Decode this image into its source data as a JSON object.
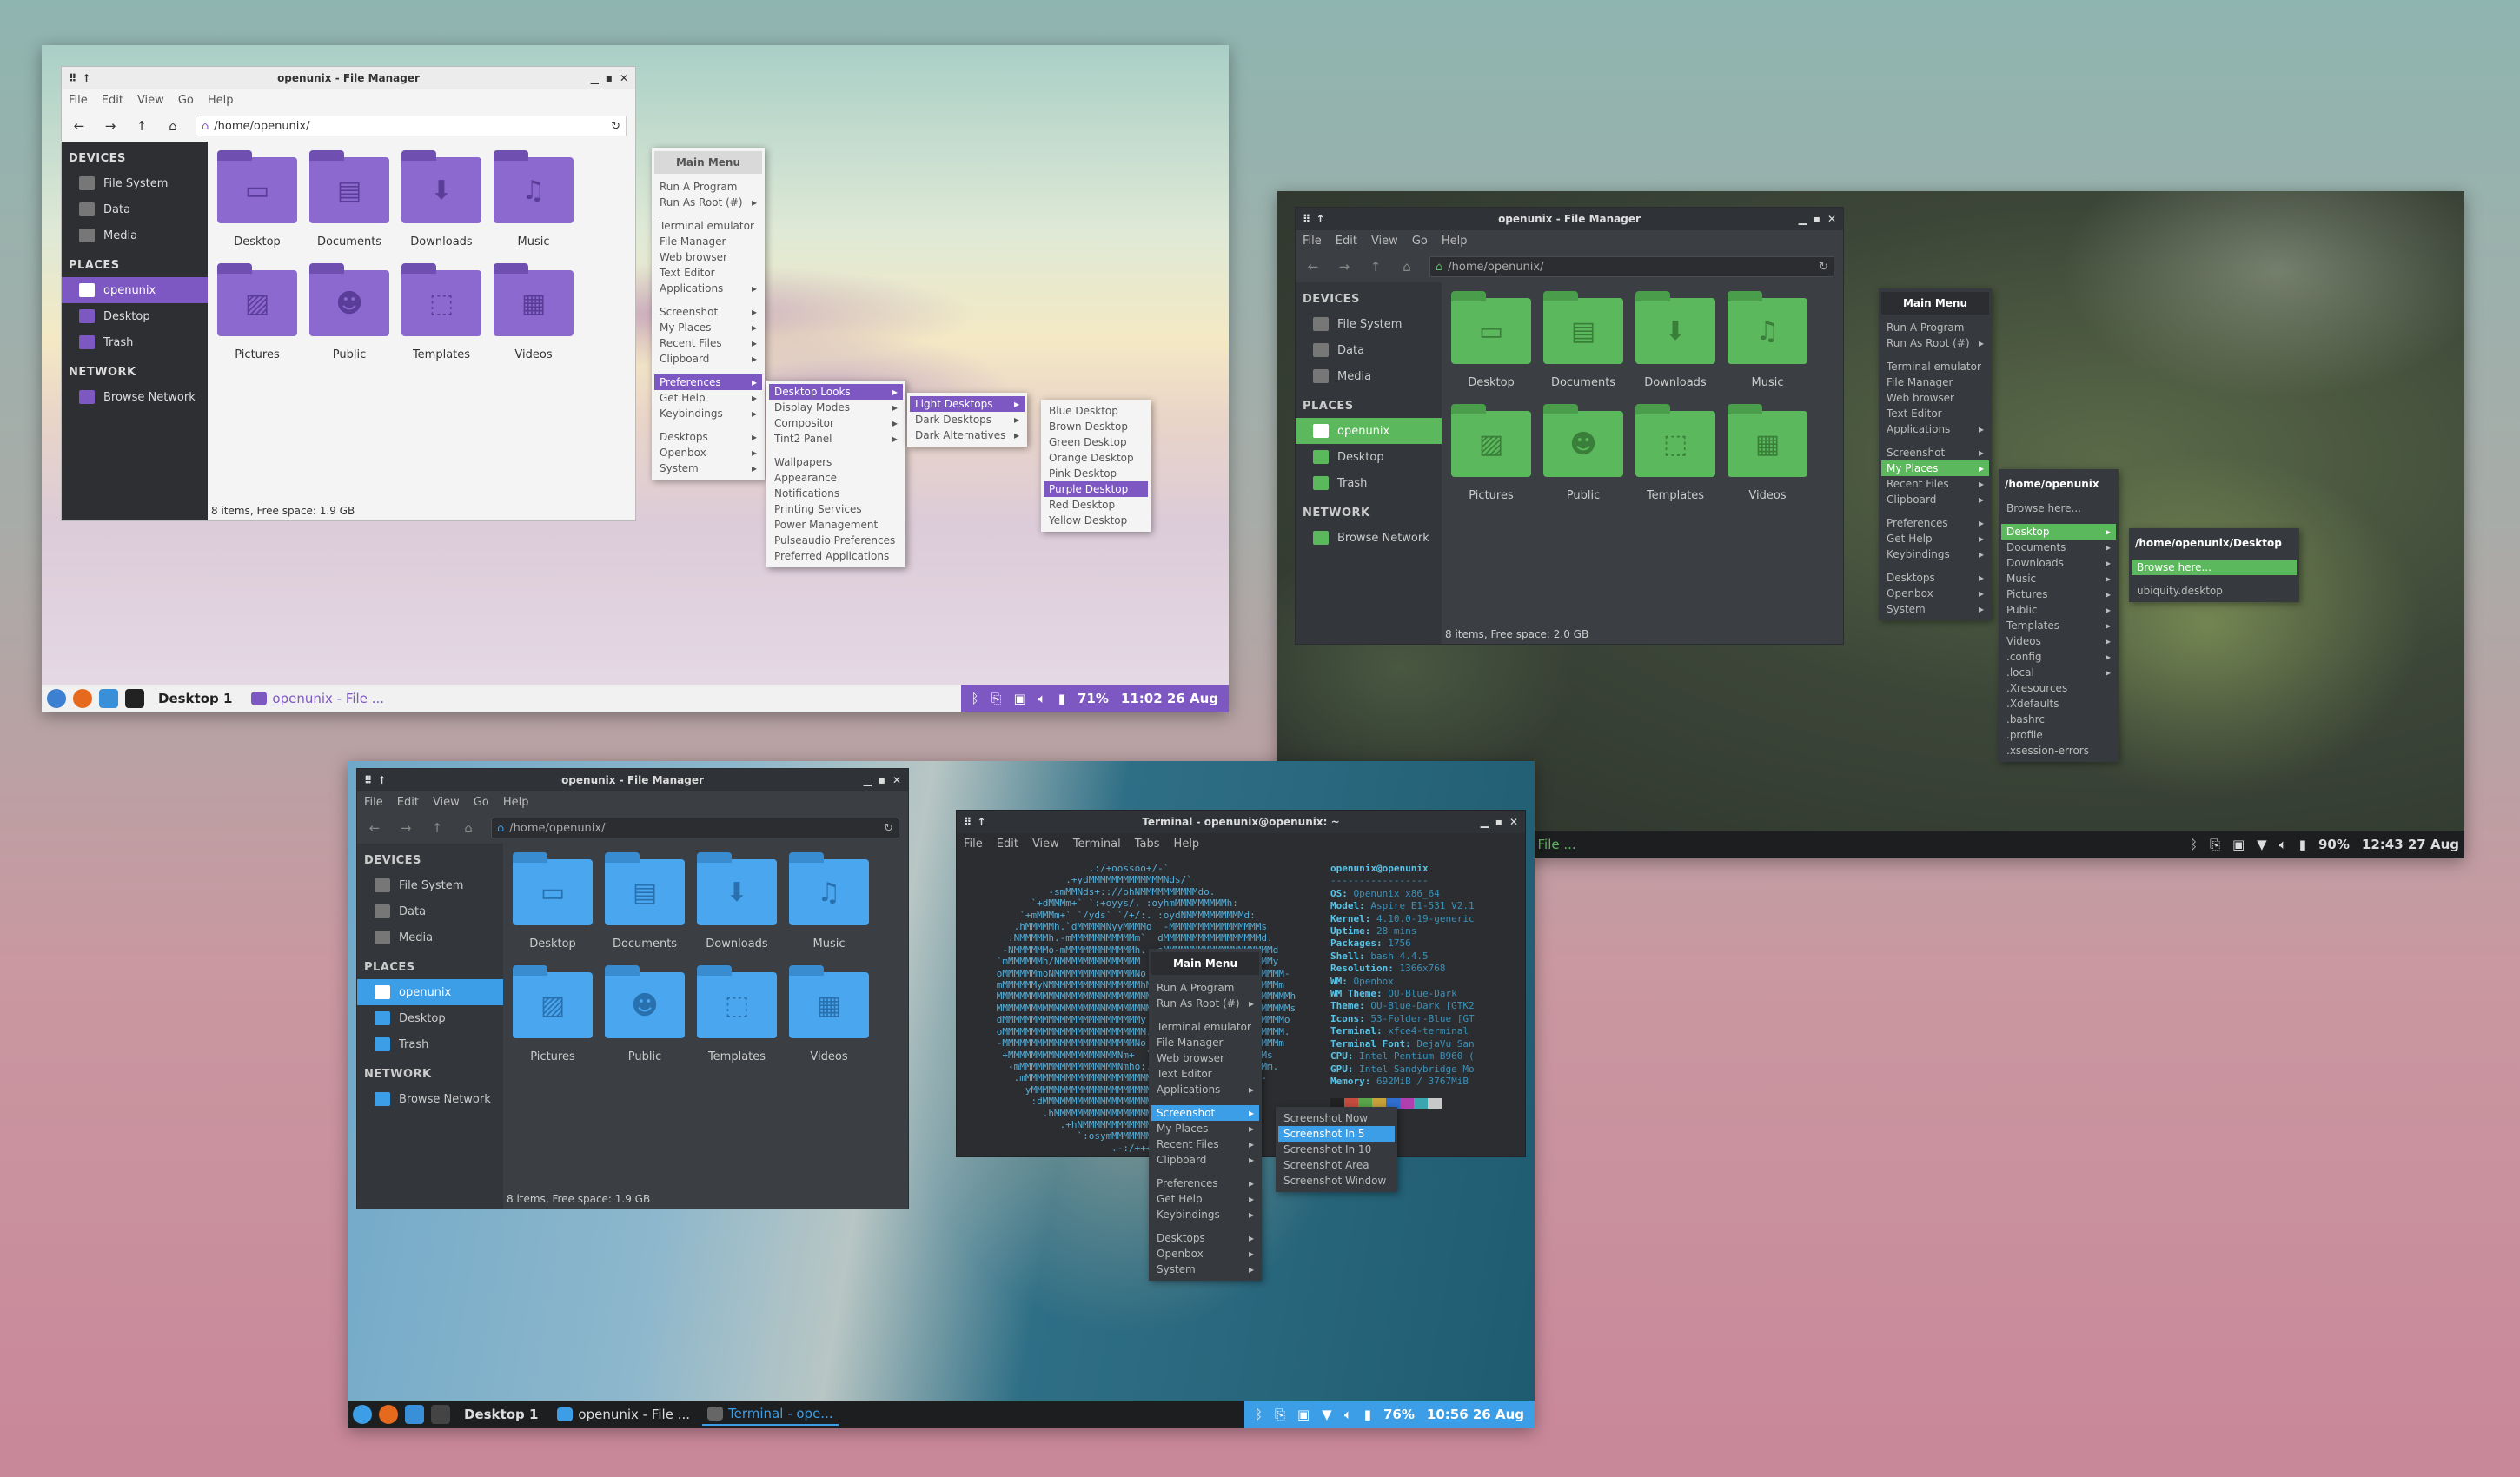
{
  "fm_menubar": [
    "File",
    "Edit",
    "View",
    "Go",
    "Help"
  ],
  "fm_path": "/home/openunix/",
  "fm_title": "openunix - File Manager",
  "sidebar": {
    "devices": "DEVICES",
    "places": "PLACES",
    "network": "NETWORK",
    "device_items": [
      "File System",
      "Data",
      "Media"
    ],
    "place_items": [
      "openunix",
      "Desktop",
      "Trash"
    ],
    "network_items": [
      "Browse Network"
    ]
  },
  "folders": [
    "Desktop",
    "Documents",
    "Downloads",
    "Music",
    "Pictures",
    "Public",
    "Templates",
    "Videos"
  ],
  "folder_icons": [
    "desktop-icon",
    "document-icon",
    "download-icon",
    "music-icon",
    "pictures-icon",
    "users-icon",
    "template-icon",
    "video-icon"
  ],
  "shot1": {
    "status": "8 items, Free space: 1.9 GB",
    "accent": "#7d57c2",
    "main_menu": {
      "title": "Main Menu",
      "items": [
        "Run A Program",
        "Run As Root (#)",
        "",
        "Terminal emulator",
        "File Manager",
        "Web browser",
        "Text Editor",
        "Applications",
        "",
        "Screenshot",
        "My Places",
        "Recent Files",
        "Clipboard",
        "",
        "Preferences",
        "Get Help",
        "Keybindings",
        "",
        "Desktops",
        "Openbox",
        "System"
      ]
    },
    "pref_menu": [
      "Desktop Looks",
      "Display Modes",
      "Compositor",
      "Tint2 Panel",
      "",
      "Wallpapers",
      "Appearance",
      "Notifications",
      "Printing Services",
      "Power Management",
      "Pulseaudio Preferences",
      "Preferred Applications"
    ],
    "looks_menu": [
      "Light Desktops",
      "Dark Desktops",
      "Dark Alternatives"
    ],
    "light_menu": [
      "Blue Desktop",
      "Brown Desktop",
      "Green Desktop",
      "Orange Desktop",
      "Pink Desktop",
      "Purple Desktop",
      "Red Desktop",
      "Yellow Desktop"
    ],
    "panel": {
      "desktop": "Desktop 1",
      "task": "openunix - File ...",
      "battery": "71%",
      "clock": "11:02 26 Aug"
    }
  },
  "shot2": {
    "status": "8 items, Free space: 2.0 GB",
    "accent": "#5cb85c",
    "main_menu": {
      "title": "Main Menu",
      "items": [
        "Run A Program",
        "Run As Root (#)",
        "",
        "Terminal emulator",
        "File Manager",
        "Web browser",
        "Text Editor",
        "Applications",
        "",
        "Screenshot",
        "My Places",
        "Recent Files",
        "Clipboard",
        "",
        "Preferences",
        "Get Help",
        "Keybindings",
        "",
        "Desktops",
        "Openbox",
        "System"
      ]
    },
    "places_menu": {
      "title": "/home/openunix",
      "browse": "Browse here...",
      "items": [
        "Desktop",
        "Documents",
        "Downloads",
        "Music",
        "Pictures",
        "Public",
        "Templates",
        "Videos",
        ".config",
        ".local",
        ".Xresources",
        ".Xdefaults",
        ".bashrc",
        ".profile",
        ".xsession-errors"
      ]
    },
    "desktop_menu": {
      "title": "/home/openunix/Desktop",
      "browse": "Browse here...",
      "items": [
        "ubiquity.desktop"
      ]
    },
    "panel": {
      "task": "nix - File ...",
      "battery": "90%",
      "clock": "12:43 27 Aug"
    }
  },
  "shot3": {
    "status": "8 items, Free space: 1.9 GB",
    "accent": "#3d9ee8",
    "term_title": "Terminal - openunix@openunix: ~",
    "term_menubar": [
      "File",
      "Edit",
      "View",
      "Terminal",
      "Tabs",
      "Help"
    ],
    "logo": [
      "                      .:/+oossoo+/-`",
      "                  .+ydMMMMMMMMMMMMMNds/`",
      "               -smMMNds+:://ohNMMMMMMMMMMdo.",
      "            `+dMMMm+` `:+oyys/. :oyhmMMMMMMMMMh:",
      "          `+mMMMm+` `/yds` `/+/:. :oydNMMMMMMMMMMd:",
      "         .hMMMMMh.`dMMMMMNyyMMMMo  -MMMMMMMMMMMMMMMMs",
      "        :NMMMMMh.-mMMMMMMMMMMMm`  dMMMMMMMMMMMMMMMMMd.",
      "       -NMMMMMMo-mMMMMMMMMMMMMh.  oMMMMMMMMMMMMMMMMMMMd",
      "      `mMMMMMMh/NMMMMMMMMMMMMMM  hMMMMMMMMMMMMMMMMMMMMy",
      "      oMMMMMMmoNMMMMMMMMMMMMMMNo `dMMMMMMMMMMMMMMMMMMMMM-",
      "      mMMMMMMyNMMMMMMMMMMMMMMMMhMMMMMMMMMMMMMMMMMMMMMMMm",
      "      MMMMMMMMMMMMMMMMMMMMMMMMMMMMMMMMMMMMMMMMMMMMMMMMMMMh",
      "      MMMMMMMMMMMMMMMMMMMMMMMMMMM/ MMMMMMMMMMMMMMMMMMMMMMs",
      "      dMMMMMMMMMMMMMMMMMMMMMMMMy  MMMMMMMMMMMMMMMMMMMMMMo",
      "      oMMMMMMMMMMMMMMMMMMMMMMMMM. hMMMMMMMMMMMMMMMMMMMMM.",
      "      -MMMMMMMMMMMMMMMMMMMMMMMNo  smMMMMMMMMMMMMMMMMMMMm",
      "       +MMMMMMMMMMMMMMMMMMMNm+  `-odMMMMMMMMMMMMMMMMMs",
      "        -mMMMMMMMMMMMMMMMMMNmho:.` `-+yNMMMMMMMMMMMMMm.",
      "         .mMMMMMMMMMMMMMMMMMMMMMMMMMMMMMMMMMMMMMMMMm-",
      "           yMMMMMMMMMMMMMMMMMMMMMMMMMMMMMMMMMMMMMMy`",
      "            :dMMMMMMMMMMMMMMMMMMMMMMMMMMMMMMMMMMd:",
      "              .hMMMMMMMMMMMMMMMMMMMMMMMMMMMMMh.",
      "                 .+hNMMMMMMMMMMMMMMMMMMMNh+.",
      "                    `:osymMMMMMMMMmyso:`",
      "                          .-:/+++/:-."
    ],
    "user": "openunix@openunix",
    "info": [
      [
        "OS:",
        "Openunix x86_64"
      ],
      [
        "Model:",
        "Aspire E1-531 V2.1"
      ],
      [
        "Kernel:",
        "4.10.0-19-generic"
      ],
      [
        "Uptime:",
        "28 mins"
      ],
      [
        "Packages:",
        "1756"
      ],
      [
        "Shell:",
        "bash 4.4.5"
      ],
      [
        "Resolution:",
        "1366x768"
      ],
      [
        "WM:",
        "Openbox"
      ],
      [
        "WM Theme:",
        "OU-Blue-Dark"
      ],
      [
        "Theme:",
        "OU-Blue-Dark [GTK2"
      ],
      [
        "Icons:",
        "53-Folder-Blue [GT"
      ],
      [
        "Terminal:",
        "xfce4-terminal"
      ],
      [
        "Terminal Font:",
        "DejaVu San"
      ],
      [
        "CPU:",
        "Intel Pentium B960 ("
      ],
      [
        "GPU:",
        "Intel Sandybridge Mo"
      ],
      [
        "Memory:",
        "692MiB / 3767MiB"
      ]
    ],
    "palette": [
      "#222222",
      "#c44d3f",
      "#5aa64a",
      "#c9a23a",
      "#2f6fd0",
      "#b03fb0",
      "#3aa6b0",
      "#c8c8c8"
    ],
    "main_menu": {
      "title": "Main Menu",
      "items": [
        "Run A Program",
        "Run As Root (#)",
        "",
        "Terminal emulator",
        "File Manager",
        "Web browser",
        "Text Editor",
        "Applications",
        "",
        "Screenshot",
        "My Places",
        "Recent Files",
        "Clipboard",
        "",
        "Preferences",
        "Get Help",
        "Keybindings",
        "",
        "Desktops",
        "Openbox",
        "System"
      ]
    },
    "shot_menu": [
      "Screenshot Now",
      "Screenshot In 5",
      "Screenshot In 10",
      "Screenshot Area",
      "Screenshot Window"
    ],
    "panel": {
      "desktop": "Desktop 1",
      "task1": "openunix - File ...",
      "task2": "Terminal - ope...",
      "battery": "76%",
      "clock": "10:56 26 Aug"
    }
  }
}
